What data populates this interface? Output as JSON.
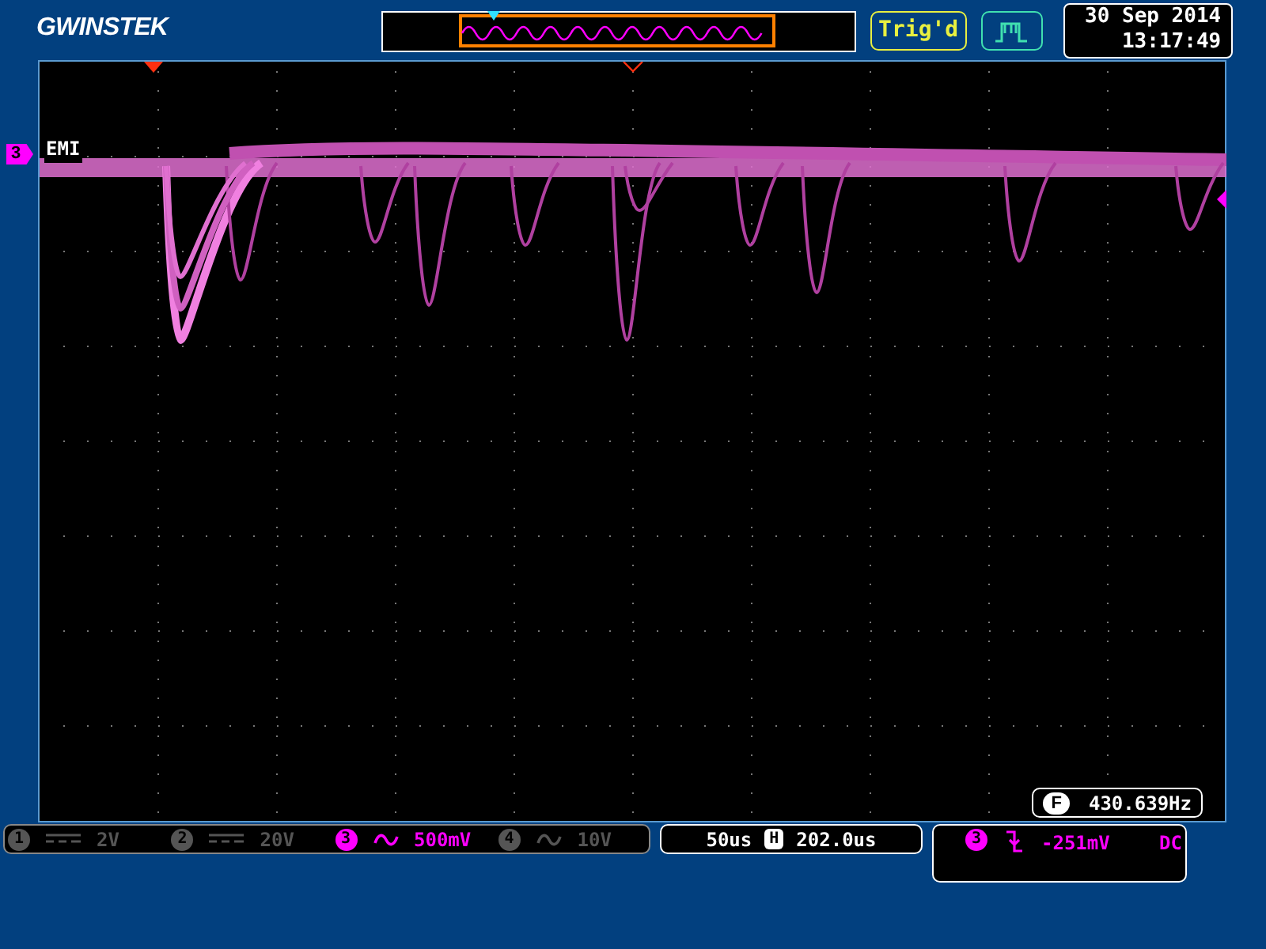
{
  "brand": "GWINSTEK",
  "acquisition_status": "Trig'd",
  "date": "30 Sep 2014",
  "time": "13:17:49",
  "channel_label": {
    "number": "3",
    "name": "EMI"
  },
  "frequency": {
    "badge": "F",
    "reading": "430.639Hz"
  },
  "channels": [
    {
      "number": "1",
      "kind": "dc",
      "scale": "2V",
      "active": false
    },
    {
      "number": "2",
      "kind": "dc",
      "scale": "20V",
      "active": false
    },
    {
      "number": "3",
      "kind": "ac",
      "scale": "500mV",
      "active": true
    },
    {
      "number": "4",
      "kind": "ac",
      "scale": "10V",
      "active": false
    }
  ],
  "timebase": {
    "scale": "50us",
    "badge": "H",
    "position": "202.0us"
  },
  "trigger": {
    "source": "3",
    "kind": "falling",
    "level": "-251mV",
    "coupling": "DC"
  }
}
